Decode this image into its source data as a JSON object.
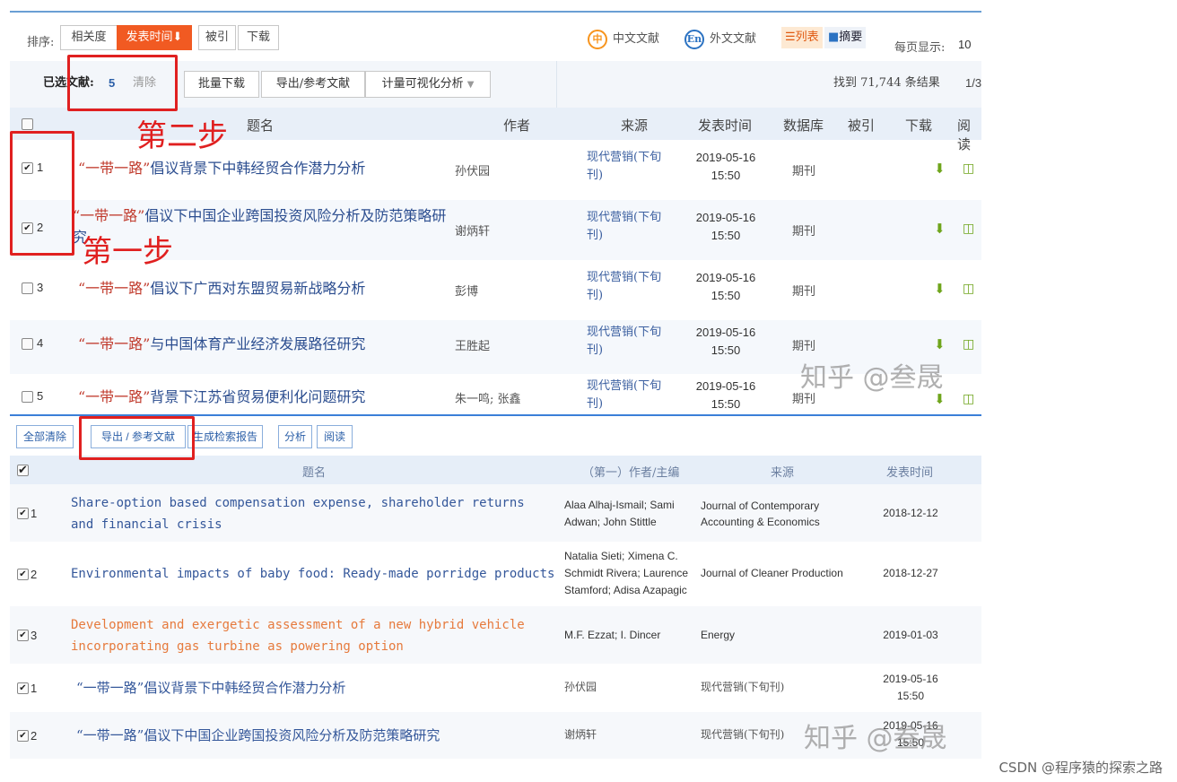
{
  "toolbar": {
    "sort_label": "排序:",
    "sort_options": [
      "相关度",
      "发表时间",
      "被引",
      "下载"
    ],
    "sort_active_arrow": "⬇",
    "lang_cn": "中文文献",
    "lang_en": "外文文献",
    "view_list": "列表",
    "view_abstract": "摘要",
    "per_page_label": "每页显示:",
    "per_page_value": "10"
  },
  "selection": {
    "label": "已选文献:",
    "count": "5",
    "clear": "清除",
    "batch_download": "批量下载",
    "export": "导出/参考文献",
    "analysis": "计量可视化分析",
    "result_text": "找到 71,744 条结果",
    "page_text": "1/3"
  },
  "table": {
    "headers": {
      "title": "题名",
      "author": "作者",
      "source": "来源",
      "date": "发表时间",
      "db": "数据库",
      "cited": "被引",
      "download": "下载",
      "read": "阅读"
    },
    "rows": [
      {
        "num": "1",
        "checked": true,
        "quote": "“一带一路”",
        "title_rest": "倡议背景下中韩经贸合作潜力分析",
        "author": "孙伏园",
        "source": "现代营销(下旬刊)",
        "date": "2019-05-16",
        "time": "15:50",
        "db": "期刊"
      },
      {
        "num": "2",
        "checked": true,
        "quote": "“一带一路”",
        "title_rest": "倡议下中国企业跨国投资风险分析及防范策略研究",
        "author": "谢炳轩",
        "source": "现代营销(下旬刊)",
        "date": "2019-05-16",
        "time": "15:50",
        "db": "期刊"
      },
      {
        "num": "3",
        "checked": false,
        "quote": "“一带一路”",
        "title_rest": "倡议下广西对东盟贸易新战略分析",
        "author": "彭博",
        "source": "现代营销(下旬刊)",
        "date": "2019-05-16",
        "time": "15:50",
        "db": "期刊"
      },
      {
        "num": "4",
        "checked": false,
        "quote": "“一带一路”",
        "title_rest": "与中国体育产业经济发展路径研究",
        "author": "王胜起",
        "source": "现代营销(下旬刊)",
        "date": "2019-05-16",
        "time": "15:50",
        "db": "期刊"
      },
      {
        "num": "5",
        "checked": false,
        "quote": "“一带一路”",
        "title_rest": "背景下江苏省贸易便利化问题研究",
        "author": "朱一鸣; 张鑫",
        "source": "现代营销(下旬刊)",
        "date": "2019-05-16",
        "time": "15:50",
        "db": "期刊"
      }
    ]
  },
  "annotations": {
    "step1": "第一步",
    "step2": "第二步"
  },
  "watermark": "知乎 @叁晟",
  "bottom": {
    "buttons": {
      "clear_all": "全部清除",
      "export": "导出 / 参考文献",
      "report": "生成检索报告",
      "analyze": "分析",
      "read": "阅读"
    },
    "headers": {
      "title": "题名",
      "author": "（第一）作者/主编",
      "source": "来源",
      "date": "发表时间"
    },
    "rows": [
      {
        "num": "1",
        "title": "Share-option based compensation expense, shareholder returns and financial crisis",
        "author": "Alaa Alhaj-Ismail; Sami Adwan; John Stittle",
        "source": "Journal of Contemporary Accounting & Economics",
        "date": "2018-12-12"
      },
      {
        "num": "2",
        "title": "Environmental impacts of baby food: Ready-made porridge products",
        "author": "Natalia Sieti; Ximena C. Schmidt Rivera; Laurence Stamford; Adisa Azapagic",
        "source": "Journal of Cleaner Production",
        "date": "2018-12-27"
      },
      {
        "num": "3",
        "title": "Development and exergetic assessment of a new hybrid vehicle incorporating gas turbine as powering option",
        "author": "M.F. Ezzat; I. Dincer",
        "source": "Energy",
        "date": "2019-01-03"
      },
      {
        "num": "1",
        "title": "“一带一路”倡议背景下中韩经贸合作潜力分析",
        "author": "孙伏园",
        "source": "现代营销(下旬刊)",
        "date": "2019-05-16",
        "time": "15:50"
      },
      {
        "num": "2",
        "title": "“一带一路”倡议下中国企业跨国投资风险分析及防范策略研究",
        "author": "谢炳轩",
        "source": "现代营销(下旬刊)",
        "date": "2019-05-16",
        "time": "15:50"
      }
    ]
  },
  "credit": "CSDN @程序猿的探索之路",
  "colors": {
    "accent_orange": "#f15a22",
    "link_blue": "#2b4d8f",
    "annotation_red": "#e02020",
    "icon_green": "#6fa51c"
  }
}
